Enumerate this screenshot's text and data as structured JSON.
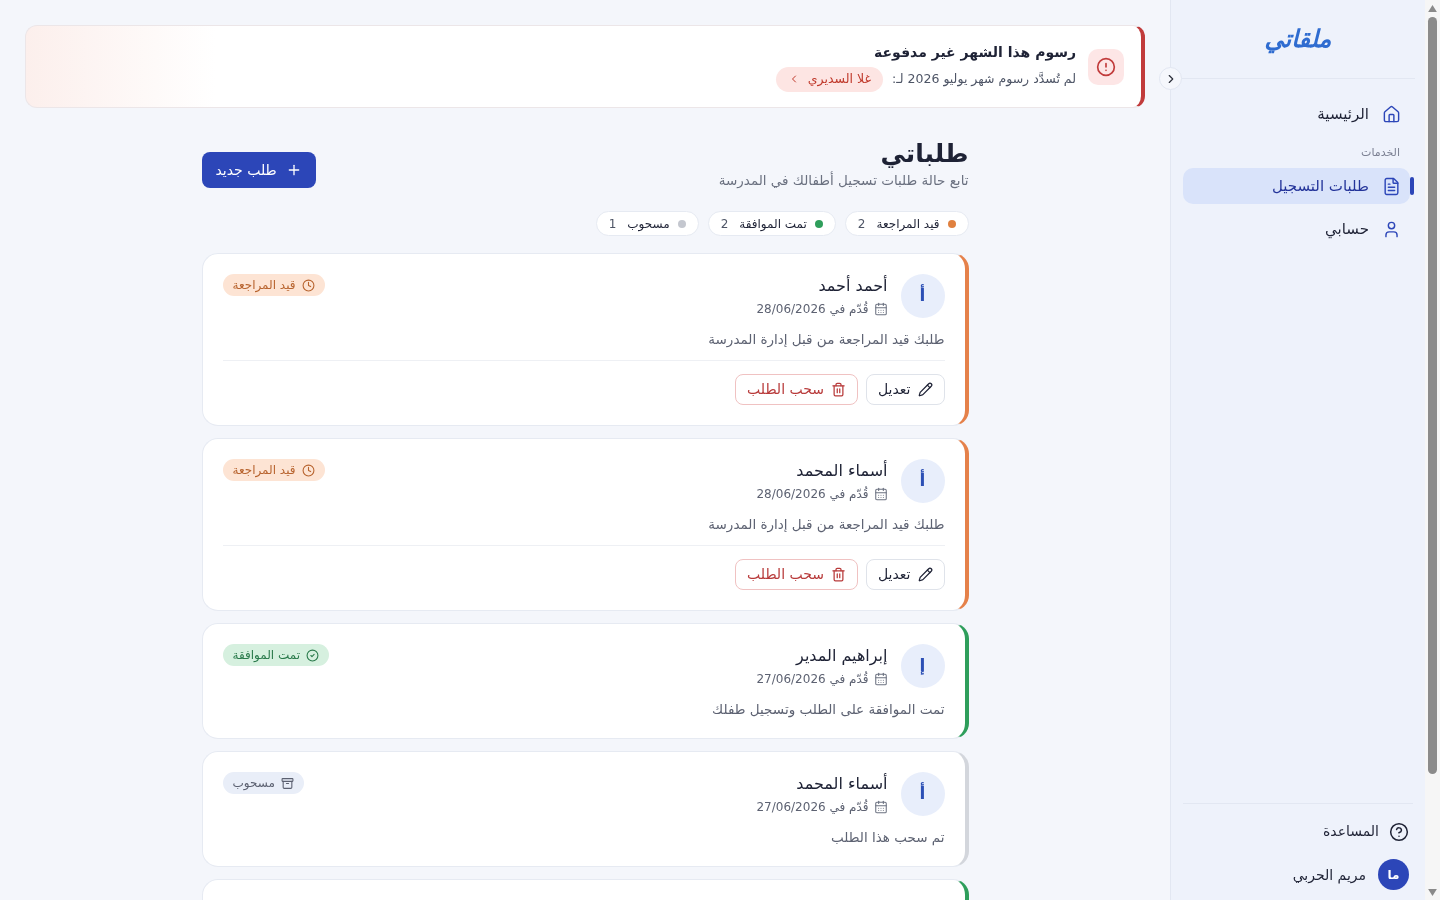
{
  "banner": {
    "title": "رسوم هذا الشهر غير مدفوعة",
    "message": "لم تُسدَّد رسوم شهر يوليو 2026 لـ:",
    "student_chip": "غلا السديري"
  },
  "page": {
    "title": "طلباتي",
    "subtitle": "تابع حالة طلبات تسجيل أطفالك في المدرسة",
    "new_button": "طلب جديد"
  },
  "filters": [
    {
      "label": "قيد المراجعة",
      "count": "2",
      "color": "#e0803f"
    },
    {
      "label": "تمت الموافقة",
      "count": "2",
      "color": "#2f9e5b"
    },
    {
      "label": "مسحوب",
      "count": "1",
      "color": "#c4c7cf"
    }
  ],
  "requests": [
    {
      "kind": "pending",
      "initial": "أ",
      "name": "أحمد أحمد",
      "date": "قُدّم في 28/06/2026",
      "badge": "قيد المراجعة",
      "message": "طلبك قيد المراجعة من قبل إدارة المدرسة",
      "actions": [
        {
          "kind": "edit",
          "label": "تعديل"
        },
        {
          "kind": "withdraw",
          "label": "سحب الطلب"
        }
      ]
    },
    {
      "kind": "pending",
      "initial": "أ",
      "name": "أسماء المحمد",
      "date": "قُدّم في 28/06/2026",
      "badge": "قيد المراجعة",
      "message": "طلبك قيد المراجعة من قبل إدارة المدرسة",
      "actions": [
        {
          "kind": "edit",
          "label": "تعديل"
        },
        {
          "kind": "withdraw",
          "label": "سحب الطلب"
        }
      ]
    },
    {
      "kind": "approved",
      "initial": "إ",
      "name": "إبراهيم المدير",
      "date": "قُدّم في 27/06/2026",
      "badge": "تمت الموافقة",
      "message": "تمت الموافقة على الطلب وتسجيل طفلك"
    },
    {
      "kind": "withdrawn",
      "initial": "أ",
      "name": "أسماء المحمد",
      "date": "قُدّم في 27/06/2026",
      "badge": "مسحوب",
      "message": "تم سحب هذا الطلب"
    },
    {
      "kind": "approved"
    }
  ],
  "sidebar": {
    "logo": "ملقاتي",
    "top_items": [
      {
        "kind": "home",
        "label": "الرئيسية",
        "selected": false
      }
    ],
    "sections": [
      {
        "title": "الخدمات",
        "items": [
          {
            "kind": "requests",
            "label": "طلبات التسجيل",
            "selected": true
          },
          {
            "kind": "account",
            "label": "حسابي",
            "selected": false
          }
        ]
      }
    ],
    "help": "المساعدة",
    "user": {
      "initials": "ما",
      "name": "مريم الحربي"
    }
  }
}
